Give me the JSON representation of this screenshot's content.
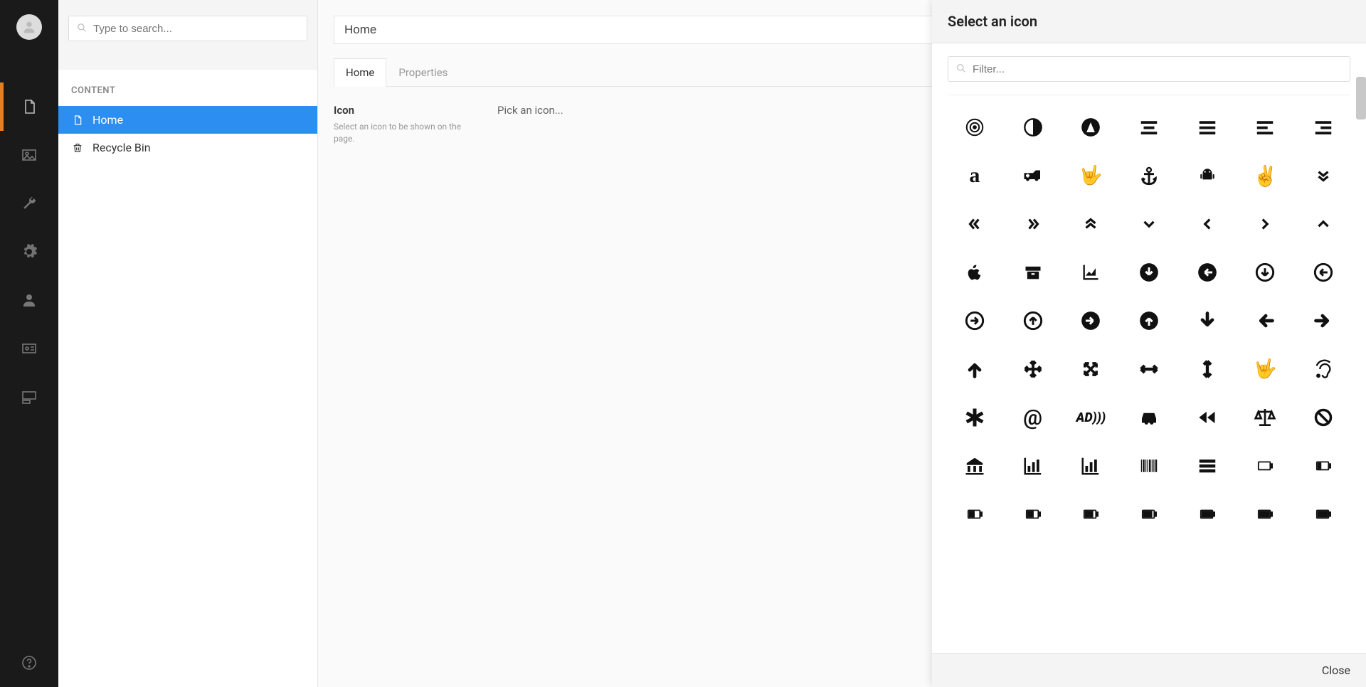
{
  "rail": {
    "items": [
      {
        "name": "content-section",
        "active": true
      },
      {
        "name": "media-section",
        "active": false
      },
      {
        "name": "settings-wrench-section",
        "active": false
      },
      {
        "name": "settings-gear-section",
        "active": false
      },
      {
        "name": "users-section",
        "active": false
      },
      {
        "name": "members-section",
        "active": false
      },
      {
        "name": "forms-section",
        "active": false
      }
    ],
    "help": "help"
  },
  "tree": {
    "search_placeholder": "Type to search...",
    "section_label": "CONTENT",
    "nodes": [
      {
        "label": "Home",
        "icon": "document-icon",
        "selected": true
      },
      {
        "label": "Recycle Bin",
        "icon": "trash-icon",
        "selected": false
      }
    ]
  },
  "editor": {
    "title": "Home",
    "tabs": [
      {
        "label": "Home",
        "active": true
      },
      {
        "label": "Properties",
        "active": false
      }
    ],
    "field": {
      "label": "Icon",
      "description": "Select an icon to be shown on the page.",
      "value": "Pick an icon..."
    }
  },
  "panel": {
    "title": "Select an icon",
    "filter_placeholder": "Filter...",
    "close_label": "Close",
    "icons": [
      "500px",
      "adjust",
      "adn",
      "align-center",
      "align-justify",
      "align-left",
      "align-right",
      "amazon",
      "ambulance",
      "asl-interpreting",
      "anchor",
      "android",
      "angellist",
      "angle-double-down",
      "angle-double-left",
      "angle-double-right",
      "angle-double-up",
      "angle-down",
      "angle-left",
      "angle-right",
      "angle-up",
      "apple",
      "archive",
      "area-chart",
      "arrow-circle-down",
      "arrow-circle-left",
      "arrow-circle-o-down",
      "arrow-circle-o-left",
      "arrow-circle-o-right",
      "arrow-circle-o-up",
      "arrow-circle-right",
      "arrow-circle-up",
      "arrow-down",
      "arrow-left",
      "arrow-right",
      "arrow-up",
      "arrows",
      "arrows-alt",
      "arrows-h",
      "arrows-v",
      "asl-interpreting-alt",
      "assistive-listening-systems",
      "asterisk",
      "at",
      "audio-description",
      "automobile",
      "backward",
      "balance-scale",
      "ban",
      "bank",
      "bar-chart",
      "bar-chart-o",
      "barcode",
      "bars",
      "battery-empty",
      "battery-quarter",
      "battery-half",
      "battery-half-2",
      "battery-three-quarters",
      "battery-three-quarters-2",
      "battery-full",
      "battery-full-2",
      "battery-full-3"
    ]
  }
}
